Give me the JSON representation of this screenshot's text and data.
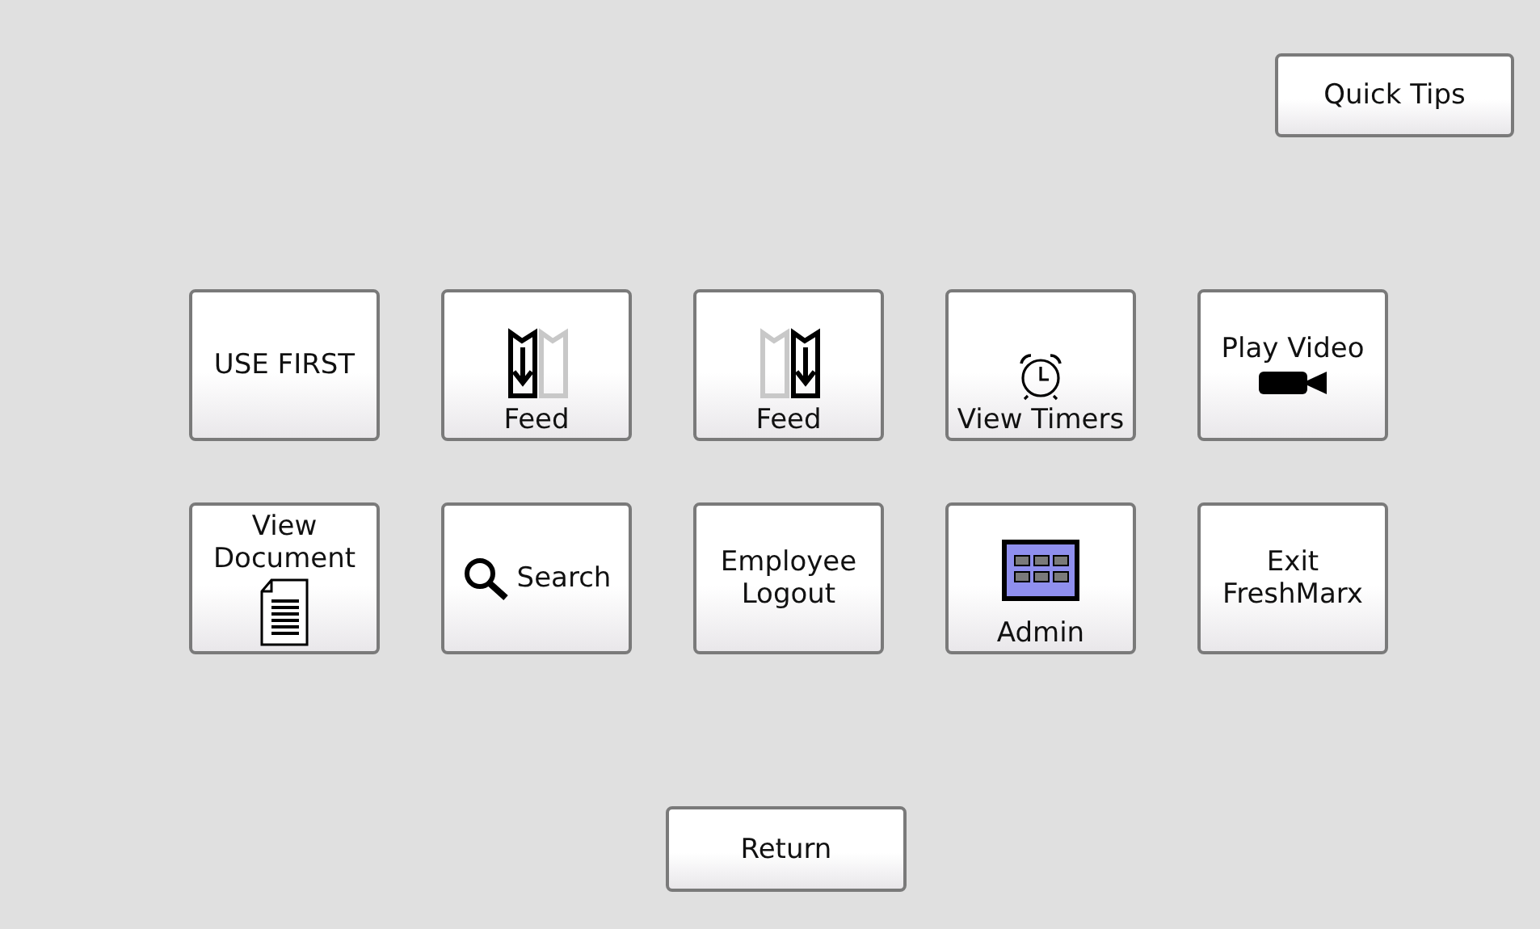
{
  "quick_tips": {
    "label": "Quick Tips"
  },
  "tiles": [
    {
      "label": "USE FIRST",
      "kind": "plain"
    },
    {
      "label": "Feed",
      "kind": "feedleft"
    },
    {
      "label": "Feed",
      "kind": "feedright"
    },
    {
      "label": "View Timers",
      "kind": "alarm"
    },
    {
      "label": "Play Video",
      "kind": "video"
    },
    {
      "label": "View\nDocument",
      "kind": "document"
    },
    {
      "label": "Search",
      "kind": "search"
    },
    {
      "label": "Employee\nLogout",
      "kind": "plain"
    },
    {
      "label": "Admin",
      "kind": "admin"
    },
    {
      "label": "Exit\nFreshMarx",
      "kind": "plain"
    }
  ],
  "return_button": {
    "label": "Return"
  }
}
